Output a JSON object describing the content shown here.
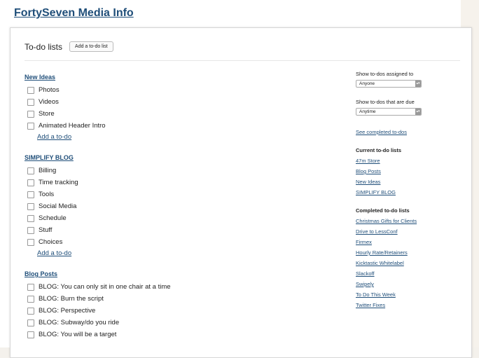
{
  "project": {
    "title": "FortySeven Media Info"
  },
  "header": {
    "title": "To-do lists",
    "add_list_label": "Add a to-do list"
  },
  "lists": [
    {
      "title": "New Ideas",
      "items": [
        "Photos",
        "Videos",
        "Store",
        "Animated Header Intro"
      ],
      "add_label": "Add a to-do"
    },
    {
      "title": "SIMPLIFY BLOG",
      "items": [
        "Billing",
        "Time tracking",
        "Tools",
        "Social Media",
        "Schedule",
        "Stuff",
        "Choices"
      ],
      "add_label": "Add a to-do"
    },
    {
      "title": "Blog Posts",
      "items": [
        "BLOG: You can only sit in one chair at a time",
        "BLOG: Burn the script",
        "BLOG: Perspective",
        "BLOG: Subway/do you ride",
        "BLOG: You will be a target"
      ]
    }
  ],
  "sidebar": {
    "assigned_label": "Show to-dos assigned to",
    "assigned_value": "Anyone",
    "due_label": "Show to-dos that are due",
    "due_value": "Anytime",
    "see_completed": "See completed to-dos",
    "current_heading": "Current to-do lists",
    "current_lists": [
      "47m Store",
      "Blog Posts",
      "New Ideas",
      "SIMPLIFY BLOG"
    ],
    "completed_heading": "Completed to-do lists",
    "completed_lists": [
      "Christmas Gifts for Clients",
      "Drive to LessConf",
      "Firmex",
      "Hourly Rate/Retainers",
      "Kicktastic Whitelabel",
      "Slackoff",
      "Swipely",
      "To Do This Week",
      "Twitter Fixes"
    ]
  }
}
